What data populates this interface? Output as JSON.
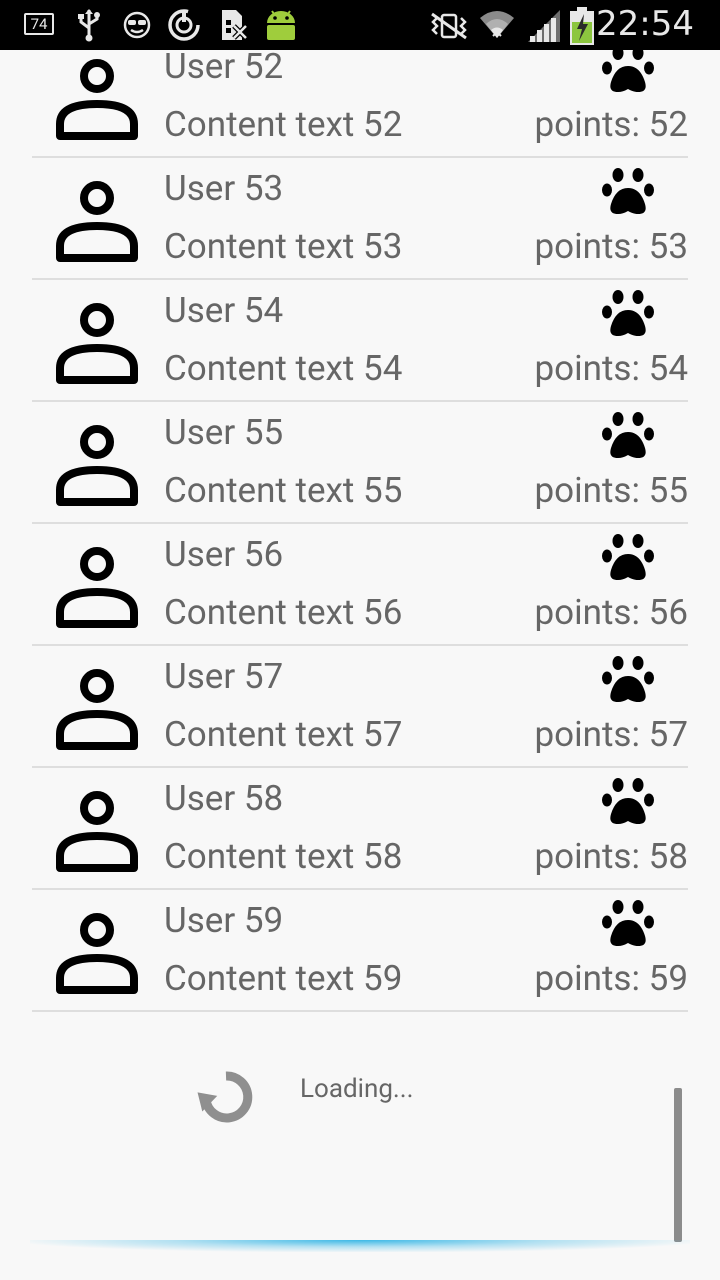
{
  "status_bar": {
    "notification_badge": "74",
    "time": "22:54",
    "icons": [
      "usb-icon",
      "sunglasses-icon",
      "sync-icon",
      "sim-off-icon",
      "android-icon",
      "vibrate-icon",
      "wifi-icon",
      "signal-icon",
      "battery-charging-icon"
    ]
  },
  "list": {
    "items": [
      {
        "user": "User 52",
        "content": "Content text 52",
        "points": "points: 52"
      },
      {
        "user": "User 53",
        "content": "Content text 53",
        "points": "points: 53"
      },
      {
        "user": "User 54",
        "content": "Content text 54",
        "points": "points: 54"
      },
      {
        "user": "User 55",
        "content": "Content text 55",
        "points": "points: 55"
      },
      {
        "user": "User 56",
        "content": "Content text 56",
        "points": "points: 56"
      },
      {
        "user": "User 57",
        "content": "Content text 57",
        "points": "points: 57"
      },
      {
        "user": "User 58",
        "content": "Content text 58",
        "points": "points: 58"
      },
      {
        "user": "User 59",
        "content": "Content text 59",
        "points": "points: 59"
      }
    ]
  },
  "loading": {
    "label": "Loading..."
  },
  "colors": {
    "background": "#f8f8f8",
    "text": "#666666",
    "divider": "#dedede",
    "overscroll_glow": "#33b5e5"
  }
}
